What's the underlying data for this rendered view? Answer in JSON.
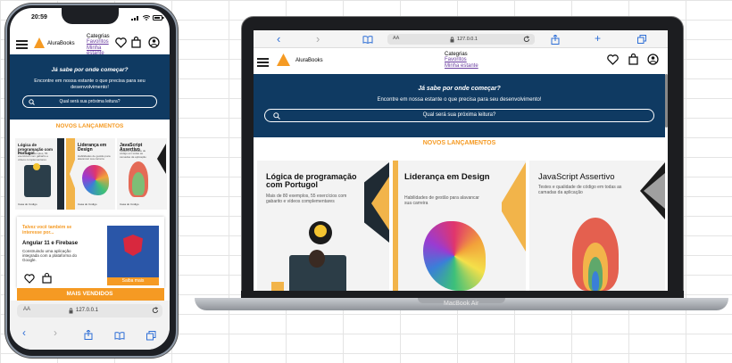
{
  "phone": {
    "status": {
      "time": "20:59"
    },
    "nav": {
      "brand": "AluraBooks",
      "links": [
        "Categrias",
        "Favoritos",
        "Minha estante"
      ]
    },
    "hero": {
      "title": "Já sabe por onde começar?",
      "subtitle": "Encontre em nossa estante o que precisa para seu desenvolvimento!",
      "search_placeholder": "Qual será sua próxima leitura?"
    },
    "section_new": "NOVOS LANÇAMENTOS",
    "books": [
      {
        "title": "Lógica de programação com Portugol",
        "sub": "Mais de 80 exemplos, 55 exercícios com gabarito e vídeos complementares",
        "footer": "Casa do Código"
      },
      {
        "title": "Liderança em Design",
        "sub": "Habilidades de gestão para alavancar sua carreira",
        "footer": "Casa do Código"
      },
      {
        "title": "JavaScript Assertivo",
        "sub": "Testes e qualidade de código em todas as camadas da aplicação",
        "footer": "Casa do Código"
      }
    ],
    "promo": {
      "heading": "Talvez você também se interesse por...",
      "title": "Angular 11 e Firebase",
      "text": "Construindo uma aplicação integrada com a plataforma do Google.",
      "button": "Saiba mais"
    },
    "section_best": "MAIS VENDIDOS",
    "browser": {
      "aa": "AA",
      "url": "127.0.0.1"
    }
  },
  "laptop": {
    "browser": {
      "aa": "AA",
      "url": "127.0.0.1"
    },
    "nav": {
      "brand": "AluraBooks",
      "links": [
        "Categrias",
        "Favoritos",
        "Minha estante"
      ]
    },
    "hero": {
      "title": "Já sabe por onde começar?",
      "subtitle": "Encontre em nossa estante o que precisa para seu desenvolvimento!",
      "search_placeholder": "Qual será sua próxima leitura?"
    },
    "section_new": "NOVOS LANÇAMENTOS",
    "books": [
      {
        "title": "Lógica de programação com Portugol",
        "sub": "Mais de 80 exemplos, 55 exercícios com gabarito e vídeos complementares"
      },
      {
        "title": "Liderança em Design",
        "sub": "Habilidades de gestão para alavancar sua carreira"
      },
      {
        "title": "JavaScript Assertivo",
        "sub": "Testes e qualidade de código em todas as camadas da aplicação"
      }
    ],
    "device_label": "MacBook Air"
  },
  "colors": {
    "brand": "#f59a23",
    "hero": "#0f3a62",
    "link": "#6b3fa0"
  }
}
